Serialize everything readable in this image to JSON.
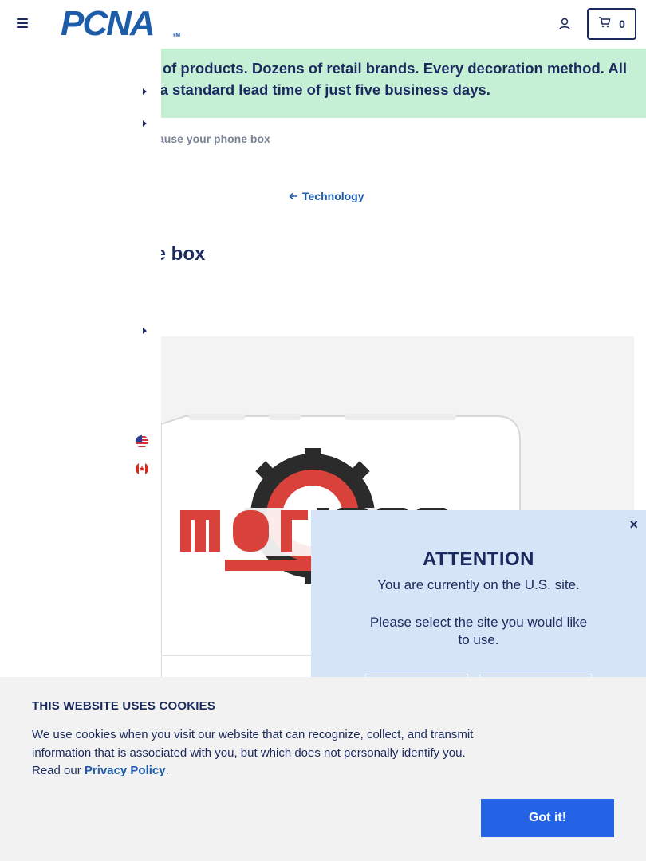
{
  "header": {
    "logo_text": "PCNA",
    "logo_tm": "TM",
    "cart_count": "0"
  },
  "promo": {
    "line1": "ls of products. Dozens of retail brands. Every decoration method. All",
    "line2": "th a standard lead time of just five business days."
  },
  "breadcrumb": {
    "partial": "ause your phone box"
  },
  "back_link": {
    "label": "Technology"
  },
  "product": {
    "title_partial": "ne box"
  },
  "attention": {
    "close": "×",
    "title": "ATTENTION",
    "line1": "You are currently on the U.S. site.",
    "line2": "Please select the site you would like to use."
  },
  "cookie": {
    "title": "THIS WEBSITE USES COOKIES",
    "body": "We use cookies when you visit our website that can recognize, collect, and transmit information that is associated with you, but which does not personally identify you. Read our ",
    "link": "Privacy Policy",
    "end": ".",
    "button": "Got it!"
  },
  "colors": {
    "brand_navy": "#1b2a5e",
    "brand_blue": "#1d5ca8",
    "promo_green": "#c6f0d6",
    "modal_blue": "#d6e4f7",
    "cookie_button": "#2463e6"
  },
  "icons": [
    "menu-icon",
    "account-icon",
    "cart-icon",
    "arrow-left-icon",
    "caret-right-icon",
    "us-flag-icon",
    "ca-flag-icon",
    "close-icon"
  ]
}
